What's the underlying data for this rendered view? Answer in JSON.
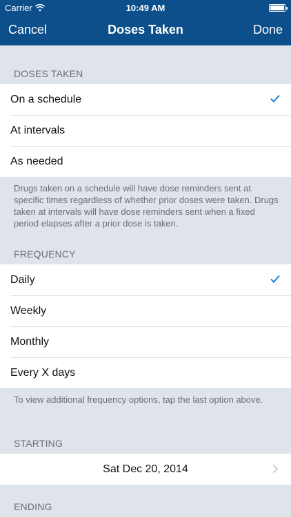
{
  "status": {
    "carrier": "Carrier",
    "time": "10:49 AM"
  },
  "nav": {
    "cancel": "Cancel",
    "title": "Doses Taken",
    "done": "Done"
  },
  "doses": {
    "header": "DOSES TAKEN",
    "options": [
      "On a schedule",
      "At intervals",
      "As needed"
    ],
    "selected": "On a schedule",
    "footer": "Drugs taken on a schedule will have dose reminders sent at specific times regardless of whether prior doses were taken. Drugs taken at intervals will have dose reminders sent when a fixed period elapses after a prior dose is taken."
  },
  "frequency": {
    "header": "FREQUENCY",
    "options": [
      "Daily",
      "Weekly",
      "Monthly",
      "Every X days"
    ],
    "selected": "Daily",
    "footer": "To view additional frequency options, tap the last option above."
  },
  "starting": {
    "header": "STARTING",
    "date": "Sat Dec 20, 2014"
  },
  "ending": {
    "header": "ENDING"
  },
  "colors": {
    "nav_bg": "#0d4f8b",
    "accent": "#1a7fd4",
    "group_bg": "#dfe3ea"
  }
}
